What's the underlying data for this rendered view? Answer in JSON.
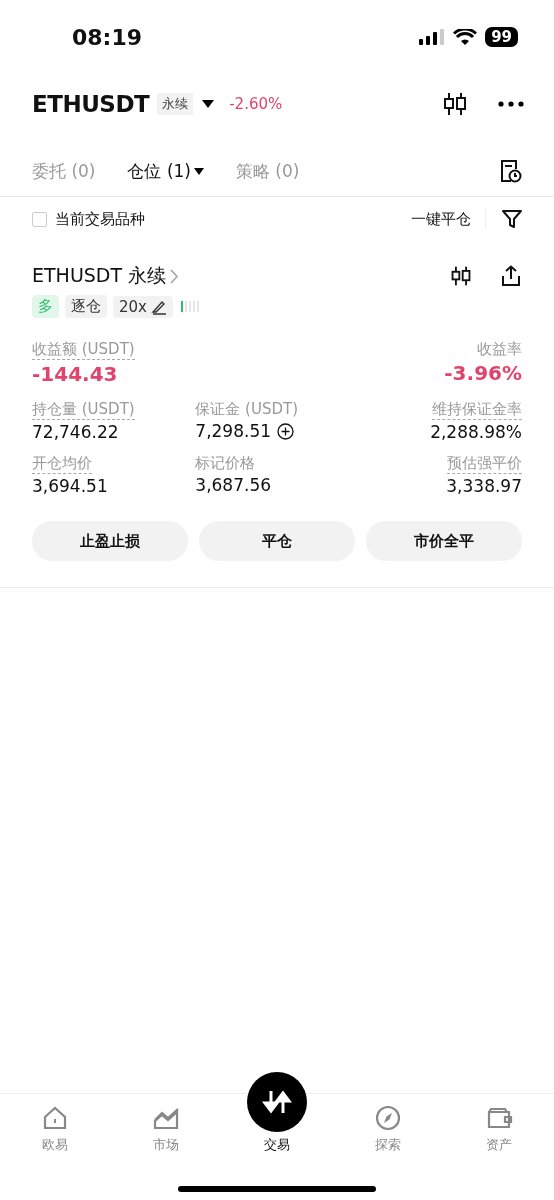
{
  "status_bar": {
    "time": "08:19",
    "battery": "99"
  },
  "header": {
    "symbol": "ETHUSDT",
    "contract_type": "永续",
    "change": "-2.60%"
  },
  "tabs": [
    {
      "label": "委托 (0)",
      "selected": false
    },
    {
      "label": "仓位 (1)",
      "selected": true
    },
    {
      "label": "策略 (0)",
      "selected": false
    }
  ],
  "filter": {
    "label": "当前交易品种",
    "checked": false,
    "close_all": "一键平仓"
  },
  "position": {
    "title": "ETHUSDT 永续",
    "side": "多",
    "margin_mode": "逐仓",
    "leverage": "20x",
    "pnl": {
      "label": "收益额 (USDT)",
      "value": "-144.43",
      "negative": true
    },
    "pnl_rate": {
      "label": "收益率",
      "value": "-3.96%",
      "negative": true
    },
    "rows": [
      [
        {
          "label": "持仓量 (USDT)",
          "value": "72,746.22",
          "underlined": true
        },
        {
          "label": "保证金 (USDT)",
          "value": "7,298.51",
          "underlined": false,
          "add_button": true
        },
        {
          "label": "维持保证金率",
          "value": "2,288.98%",
          "underlined": true
        }
      ],
      [
        {
          "label": "开仓均价",
          "value": "3,694.51",
          "underlined": true
        },
        {
          "label": "标记价格",
          "value": "3,687.56",
          "underlined": false
        },
        {
          "label": "预估强平价",
          "value": "3,338.97",
          "underlined": true
        }
      ]
    ],
    "buttons": [
      "止盈止损",
      "平仓",
      "市价全平"
    ]
  },
  "nav": [
    {
      "label": "欧易",
      "selected": false
    },
    {
      "label": "市场",
      "selected": false
    },
    {
      "label": "交易",
      "selected": true
    },
    {
      "label": "探索",
      "selected": false
    },
    {
      "label": "资产",
      "selected": false
    }
  ]
}
